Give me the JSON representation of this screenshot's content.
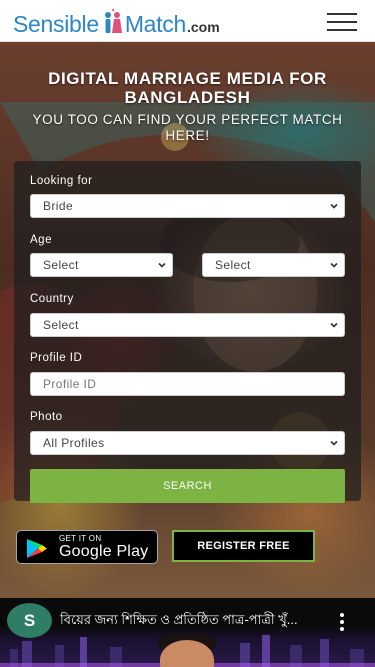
{
  "header": {
    "logo_part1": "Sensible",
    "logo_part2": "Match",
    "logo_suffix": ".com",
    "menu_icon": "hamburger-menu-icon"
  },
  "hero": {
    "title": "DIGITAL MARRIAGE MEDIA FOR BANGLADESH",
    "subtitle": "YOU TOO CAN FIND YOUR PERFECT MATCH HERE!"
  },
  "search_form": {
    "looking_for_label": "Looking for",
    "looking_for_value": "Bride",
    "age_label": "Age",
    "age_from_value": "Select",
    "age_to_value": "Select",
    "country_label": "Country",
    "country_value": "Select",
    "profile_id_label": "Profile ID",
    "profile_id_placeholder": "Profile ID",
    "photo_label": "Photo",
    "photo_value": "All Profiles",
    "search_button": "SEARCH"
  },
  "actions": {
    "google_play_small": "GET IT ON",
    "google_play_large": "Google Play",
    "register_button": "REGISTER FREE"
  },
  "video": {
    "channel_initial": "S",
    "title": "বিয়ের জন্য শিক্ষিত ও প্রতিষ্ঠিত পাত্র-পাত্রী খুঁ..."
  },
  "colors": {
    "brand_blue": "#2b87c8",
    "accent_green": "#7cb342",
    "panel_bg": "rgba(30,30,30,0.72)"
  }
}
